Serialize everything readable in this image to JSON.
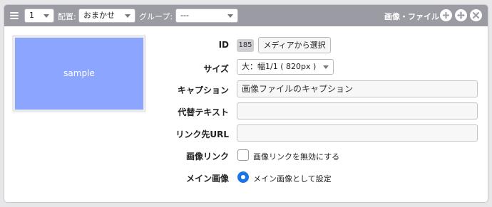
{
  "header": {
    "order_value": "1",
    "placement_label": "配置:",
    "placement_value": "おまかせ",
    "group_label": "グループ:",
    "group_value": "---",
    "unit_title": "画像・ファイル"
  },
  "preview": {
    "text": "sample"
  },
  "fields": {
    "id": {
      "label": "ID",
      "value": "185",
      "button_label": "メディアから選択"
    },
    "size": {
      "label": "サイズ",
      "value": "大：幅1/1 ( 820px )"
    },
    "caption": {
      "label": "キャプション",
      "value": "画像ファイルのキャプション"
    },
    "alt": {
      "label": "代替テキスト",
      "value": ""
    },
    "link_url": {
      "label": "リンク先URL",
      "value": ""
    },
    "image_link": {
      "label": "画像リンク",
      "option_label": "画像リンクを無効にする",
      "checked": false
    },
    "main_image": {
      "label": "メイン画像",
      "option_label": "メイン画像として設定",
      "selected": true
    }
  },
  "colors": {
    "header_bg": "#9b9ba4",
    "preview_bg": "#8ca6ff",
    "radio_accent": "#1a73e8"
  },
  "icons": [
    "menu-icon",
    "plus-circle-icon",
    "move-circle-icon",
    "close-circle-icon"
  ]
}
